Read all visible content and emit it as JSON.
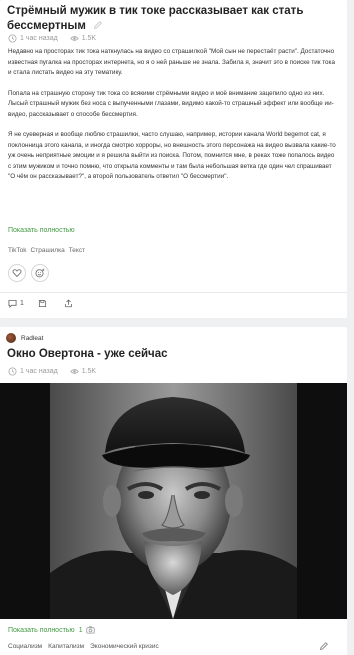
{
  "post1": {
    "title": "Стрёмный мужик в тик токе рассказывает как стать бессмертным",
    "time": "1 час назад",
    "views": "1.5K",
    "paragraphs": [
      "Недавно на просторах тик тока наткнулась на видео со страшилкой \"Мой сын не перестаёт расти\". Достаточно известная пугалка на просторах интернета, но я о ней раньше не знала. Забила я, значит это в поиске тик тока и стала листать видео на эту тематику.",
      "Попала на страшную сторону тик тока со всякими стрёмными видео и моё внимание зацепило одно из них. Лысый страшный мужик без носа с выпученными глазами, видимо какой-то страшный эффект или вообще ии-видео, рассказывает о способе бессмертия.",
      "Я не суеверная и вообще люблю страшилки, часто слушаю, например, истории канала World begemot cat, я поклонница этого канала, и иногда смотрю хорроры, но внешность этого персонажа на видео вызвала какие-то уж очень неприятные эмоции и я решила выйти из поиска. Потом, помнится мне, в реках тоже попалось видео с этим мужиком и точно помню, что открыла комменты и там была небольшая ветка где один чел спрашивает \"О чём он рассказывает?\", а второй пользователь ответил \"О бессмертии\"."
    ],
    "show_more": "Показать полностью",
    "tags": [
      "TikTok",
      "Страшилка",
      "Текст"
    ],
    "comments_count": "1"
  },
  "post2": {
    "author": "Radleat",
    "title": "Окно Овертона - уже сейчас",
    "time": "1 час назад",
    "views": "1.5K",
    "show_more": "Показать полностью",
    "images_count": "1",
    "tags": [
      "Социализм",
      "Капитализм",
      "Экономический кризис"
    ]
  }
}
